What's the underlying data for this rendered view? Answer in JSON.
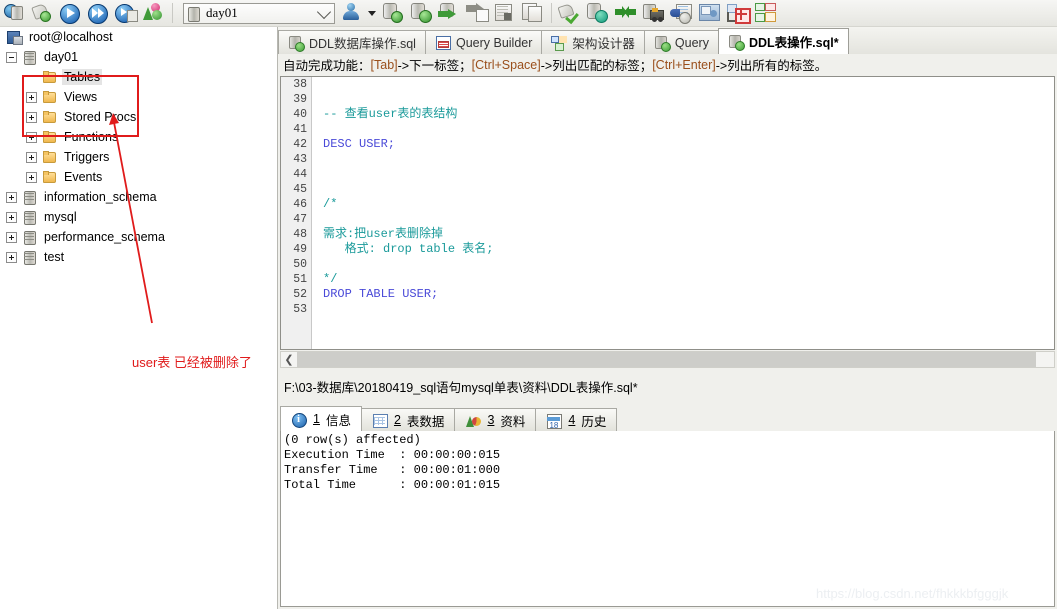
{
  "toolbar": {
    "database_selector": {
      "value": "day01",
      "icon": "database-icon"
    },
    "icons": [
      "connect-manager-icon",
      "new-connection-icon",
      "execute-query-icon",
      "execute-all-queries-icon",
      "execute-query-stop-icon",
      "query-builder-icon",
      "user-manager-icon",
      "user-dropdown-icon",
      "database-new-icon",
      "import-data-icon",
      "export-data-icon",
      "backup-icon",
      "restore-icon",
      "table-diagnostics-icon",
      "copy-database-icon",
      "sync-data-icon",
      "schema-sync-icon",
      "migrate-icon",
      "scheduled-backup-icon",
      "notification-services-icon",
      "form-view-icon",
      "table-data-icon",
      "schema-designer-icon"
    ]
  },
  "tree": {
    "root": {
      "label": "root@localhost",
      "icon": "server-icon"
    },
    "items": [
      {
        "label": "day01",
        "icon": "database-icon",
        "indent": 0,
        "expander": "minus",
        "selected": false
      },
      {
        "label": "Tables",
        "icon": "folder-icon",
        "indent": 1,
        "expander": "none",
        "selected": true
      },
      {
        "label": "Views",
        "icon": "folder-icon",
        "indent": 1,
        "expander": "plus",
        "selected": false
      },
      {
        "label": "Stored Procs",
        "icon": "folder-icon",
        "indent": 1,
        "expander": "plus",
        "selected": false
      },
      {
        "label": "Functions",
        "icon": "folder-icon",
        "indent": 1,
        "expander": "plus",
        "selected": false
      },
      {
        "label": "Triggers",
        "icon": "folder-icon",
        "indent": 1,
        "expander": "plus",
        "selected": false
      },
      {
        "label": "Events",
        "icon": "folder-icon",
        "indent": 1,
        "expander": "plus",
        "selected": false
      },
      {
        "label": "information_schema",
        "icon": "database-icon",
        "indent": 0,
        "expander": "plus",
        "selected": false
      },
      {
        "label": "mysql",
        "icon": "database-icon",
        "indent": 0,
        "expander": "plus",
        "selected": false
      },
      {
        "label": "performance_schema",
        "icon": "database-icon",
        "indent": 0,
        "expander": "plus",
        "selected": false
      },
      {
        "label": "test",
        "icon": "database-icon",
        "indent": 0,
        "expander": "plus",
        "selected": false
      }
    ],
    "annotation": {
      "text": "user表 已经被删除了",
      "color": "#e01b1b"
    }
  },
  "tabs": [
    {
      "label": "DDL数据库操作.sql",
      "icon": "sql-file-icon",
      "active": false
    },
    {
      "label": "Query Builder",
      "icon": "query-builder-icon",
      "active": false
    },
    {
      "label": "架构设计器",
      "icon": "schema-designer-icon",
      "active": false
    },
    {
      "label": "Query",
      "icon": "sql-file-icon",
      "active": false
    },
    {
      "label": "DDL表操作.sql*",
      "icon": "sql-file-icon",
      "active": true
    }
  ],
  "hint": {
    "prefix": "自动完成功能：",
    "key1": "[Tab]",
    "text1": "->下一标签；",
    "key2": "[Ctrl+Space]",
    "text2": "->列出匹配的标签；",
    "key3": "[Ctrl+Enter]",
    "text3": "->列出所有的标签。"
  },
  "editor": {
    "line_numbers": [
      "38",
      "39",
      "40",
      "41",
      "42",
      "43",
      "44",
      "45",
      "46",
      "47",
      "48",
      "49",
      "50",
      "51",
      "52",
      "53"
    ],
    "lines": [
      {
        "n": "38",
        "text": "",
        "type": "plain"
      },
      {
        "n": "39",
        "text": "",
        "type": "plain"
      },
      {
        "n": "40",
        "text": "-- 查看user表的表结构",
        "type": "comment"
      },
      {
        "n": "41",
        "text": "",
        "type": "plain"
      },
      {
        "n": "42",
        "text": "DESC USER;",
        "type": "keyword"
      },
      {
        "n": "43",
        "text": "",
        "type": "plain"
      },
      {
        "n": "44",
        "text": "",
        "type": "plain"
      },
      {
        "n": "45",
        "text": "",
        "type": "plain"
      },
      {
        "n": "46",
        "text": "/*",
        "type": "comment"
      },
      {
        "n": "47",
        "text": "",
        "type": "plain"
      },
      {
        "n": "48",
        "text": "需求:把user表删除掉",
        "type": "comment"
      },
      {
        "n": "49",
        "text": "   格式: drop table 表名;",
        "type": "comment"
      },
      {
        "n": "50",
        "text": "",
        "type": "plain"
      },
      {
        "n": "51",
        "text": "*/",
        "type": "comment"
      },
      {
        "n": "52",
        "text": "DROP TABLE USER;",
        "type": "keyword"
      },
      {
        "n": "53",
        "text": "",
        "type": "plain"
      }
    ]
  },
  "path": "F:\\03-数据库\\20180419_sql语句mysql单表\\资料\\DDL表操作.sql*",
  "result_tabs": [
    {
      "num": "1",
      "label": "信息",
      "icon": "info-icon",
      "active": true
    },
    {
      "num": "2",
      "label": "表数据",
      "icon": "grid-icon",
      "active": false
    },
    {
      "num": "3",
      "label": "资料",
      "icon": "chart-icon",
      "active": false
    },
    {
      "num": "4",
      "label": "历史",
      "icon": "calendar-icon",
      "active": false
    }
  ],
  "output": [
    "(0 row(s) affected)",
    "Execution Time  : 00:00:00:015",
    "Transfer Time   : 00:00:01:000",
    "Total Time      : 00:00:01:015"
  ],
  "watermark": "https://blog.csdn.net/fhkkkbfgggjk"
}
